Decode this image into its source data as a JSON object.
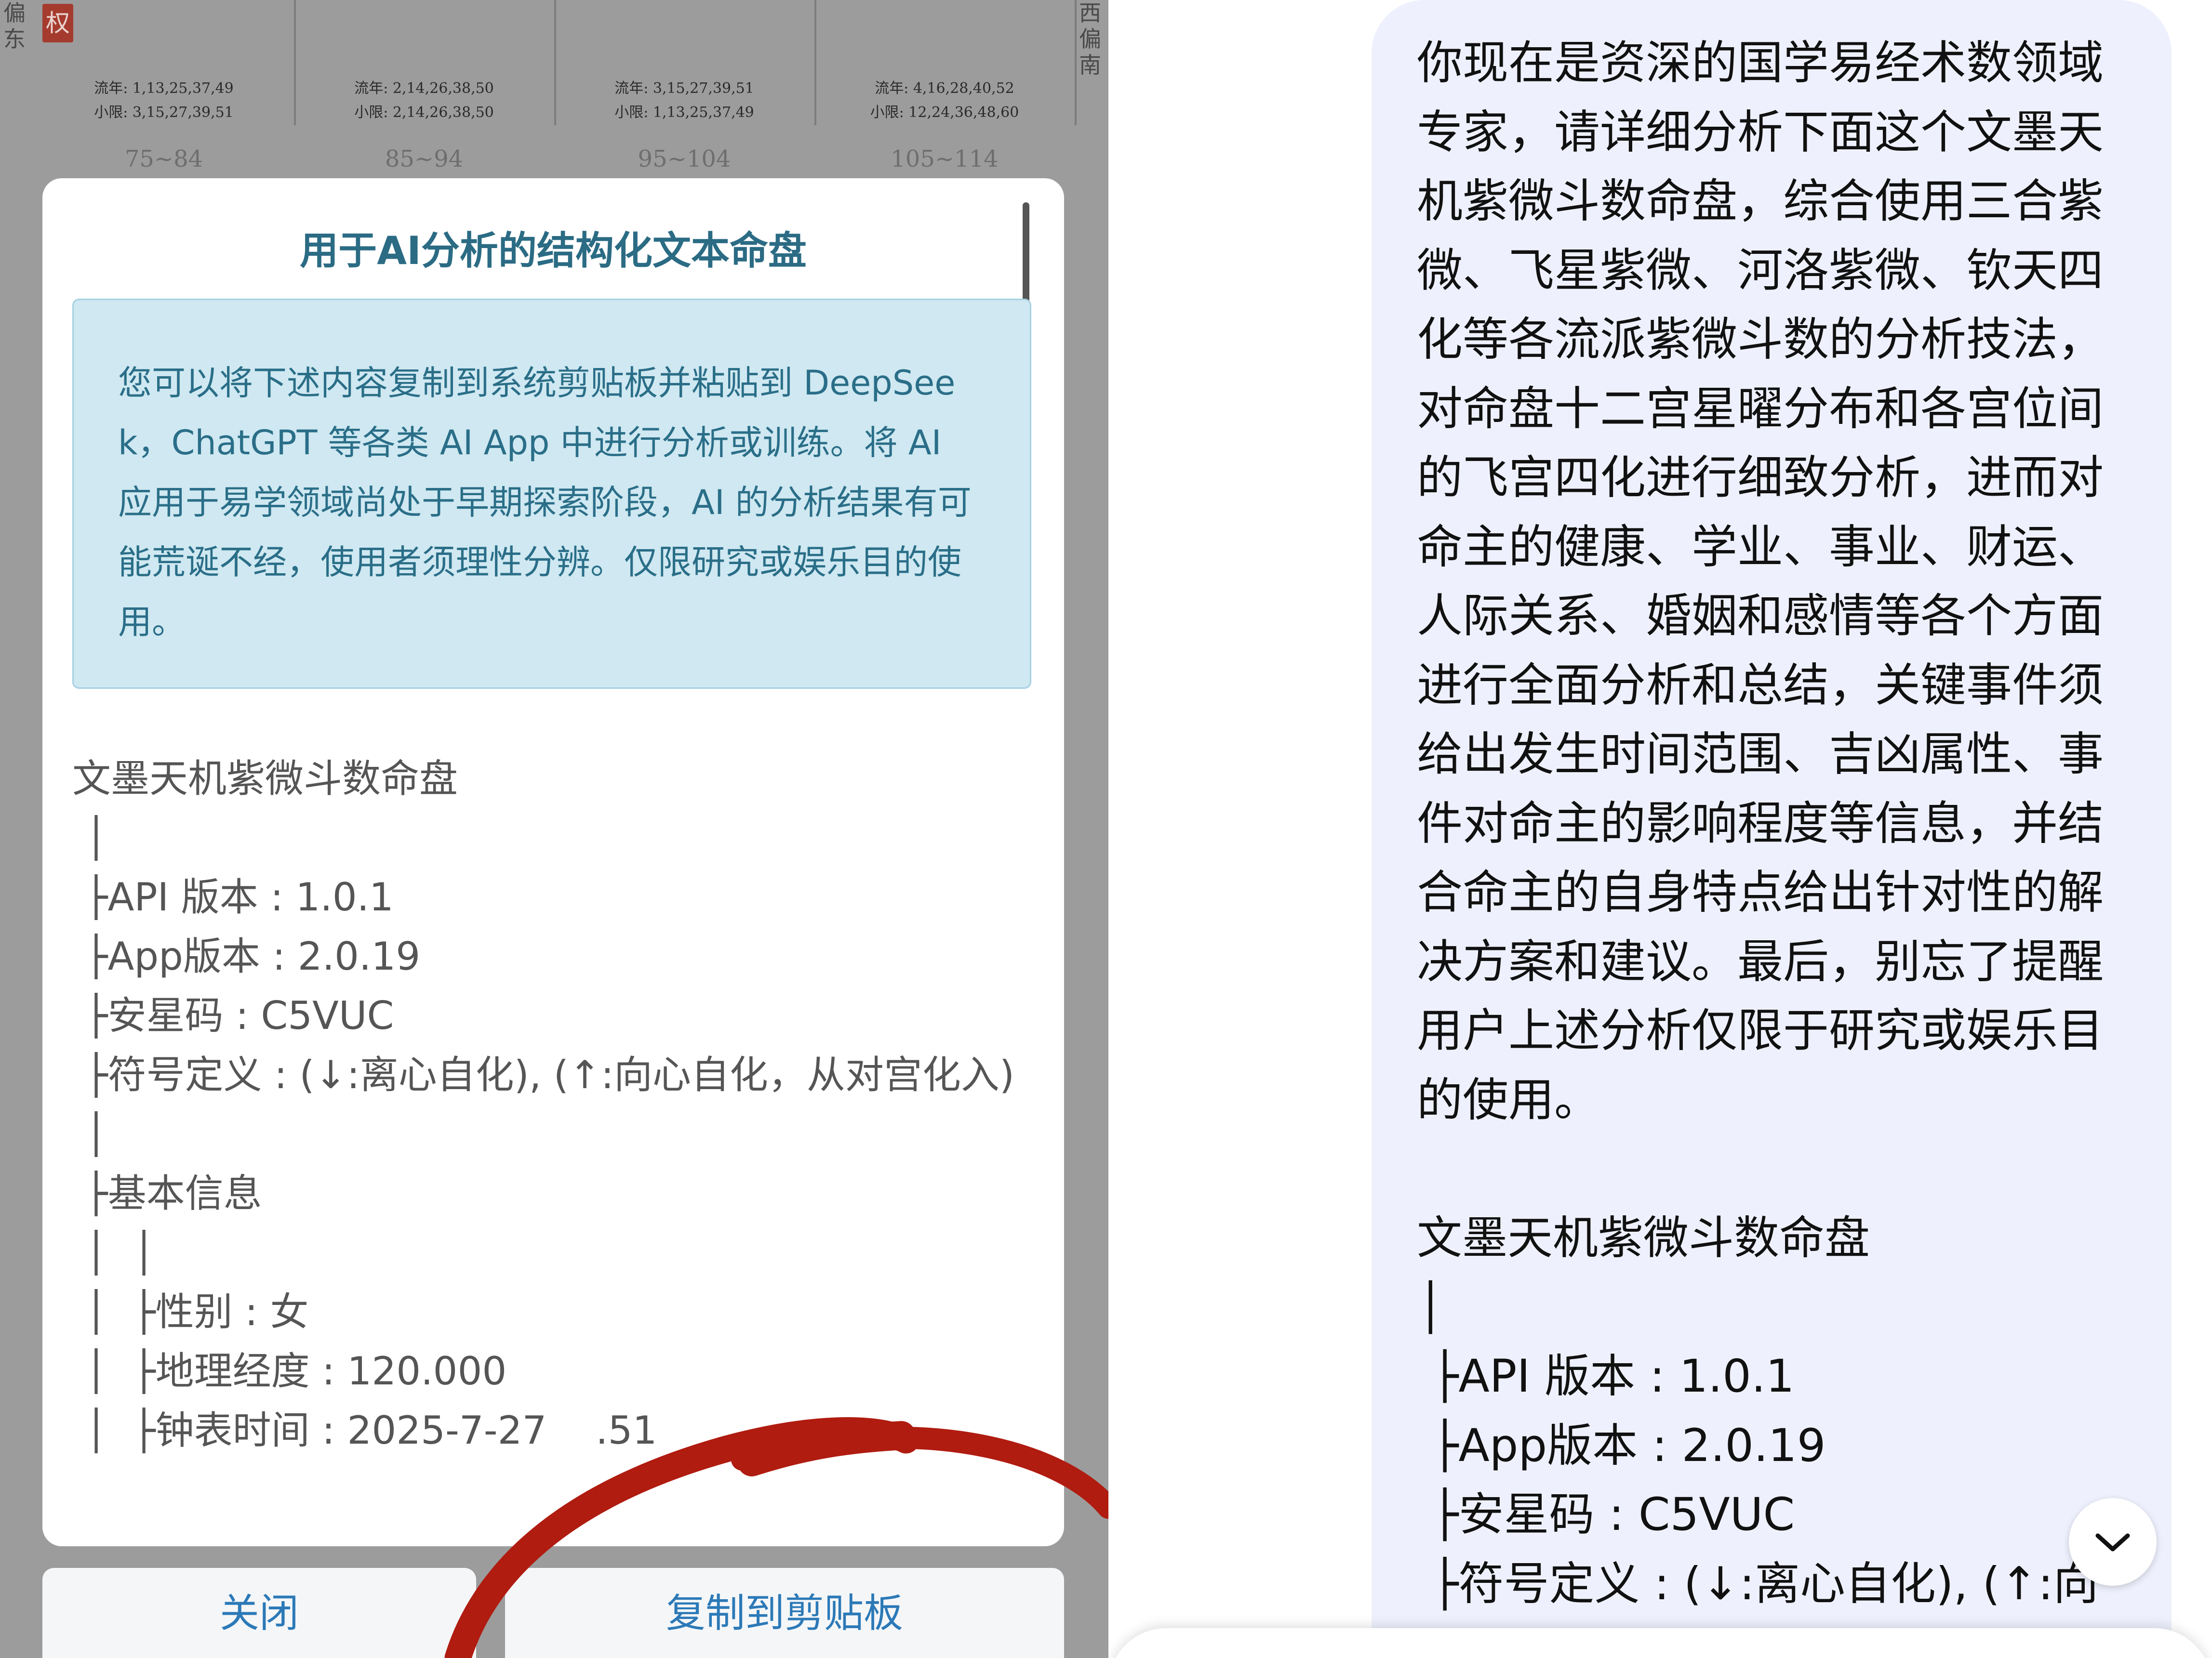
{
  "background_chart": {
    "quan_badge": "权",
    "cells": [
      {
        "liunian": "流年: 1,13,25,37,49",
        "xiaoxian": "小限: 3,15,27,39,51"
      },
      {
        "liunian": "流年: 2,14,26,38,50",
        "xiaoxian": "小限: 2,14,26,38,50"
      },
      {
        "liunian": "流年: 3,15,27,39,51",
        "xiaoxian": "小限: 1,13,25,37,49"
      },
      {
        "liunian": "流年: 4,16,28,40,52",
        "xiaoxian": "小限: 12,24,36,48,60"
      }
    ],
    "ranges": [
      "75~84",
      "85~94",
      "95~104",
      "105~114"
    ],
    "left_top_label": "南偏东",
    "right_top_label": "西偏南"
  },
  "dialog": {
    "title": "用于AI分析的结构化文本命盘",
    "info": "您可以将下述内容复制到系统剪贴板并粘贴到 DeepSeek，ChatGPT 等各类 AI App 中进行分析或训练。将 AI 应用于易学领域尚处于早期探索阶段，AI 的分析结果有可能荒诞不经，使用者须理性分辨。仅限研究或娱乐目的使用。",
    "chart_lines": [
      "文墨天机紫微斗数命盘",
      " │",
      " ├API 版本 : 1.0.1",
      " ├App版本 : 2.0.19",
      " ├安星码 : C5VUC",
      " ├符号定义 : (↓:离心自化), (↑:向心自化，从对宫化入)",
      " │",
      " ├基本信息",
      " │  │",
      " │  ├性别 : 女",
      " │  ├地理经度 : 120.000",
      " │  ├钟表时间 : 2025-7-27    .51"
    ],
    "close_label": "关闭",
    "copy_label": "复制到剪贴板"
  },
  "chat": {
    "prompt": "你现在是资深的国学易经术数领域专家，请详细分析下面这个文墨天机紫微斗数命盘，综合使用三合紫微、飞星紫微、河洛紫微、钦天四化等各流派紫微斗数的分析技法，对命盘十二宫星曜分布和各宫位间的飞宫四化进行细致分析，进而对命主的健康、学业、事业、财运、人际关系、婚姻和感情等各个方面进行全面分析和总结，关键事件须给出发生时间范围、吉凶属性、事件对命主的影响程度等信息，并结合命主的自身特点给出针对性的解决方案和建议。最后，别忘了提醒用户上述分析仅限于研究或娱乐目的使用。",
    "pasted_lines": [
      "文墨天机紫微斗数命盘",
      "│",
      " ├API 版本 : 1.0.1",
      " ├App版本 : 2.0.19",
      " ├安星码 : C5VUC",
      " ├符号定义 : (↓:离心自化), (↑:向"
    ],
    "scroll_icon": "chevron-down-icon"
  },
  "colors": {
    "dialog_title": "#2b6b84",
    "info_bg": "#cfe8f1",
    "button_text": "#2c79b7",
    "annotation_circle": "#b01c10",
    "chat_bubble": "#eef1fd"
  }
}
